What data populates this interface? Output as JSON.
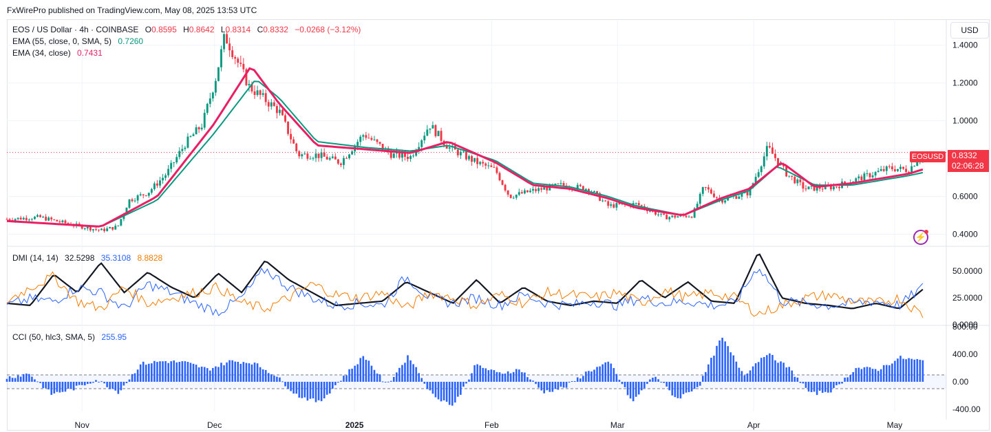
{
  "publisher": "FxWirePro published on TradingView.com, May 08, 2025 13:53 UTC",
  "currency_button": "USD",
  "legend": {
    "symbol": "EOS / US Dollar · 4h · COINBASE",
    "o_label": "O",
    "o": "0.8595",
    "h_label": "H",
    "h": "0.8642",
    "l_label": "L",
    "l": "0.8314",
    "c_label": "C",
    "c": "0.8332",
    "change": "−0.0268 (−3.12%)",
    "ema55_label": "EMA (55, close, 0, SMA, 5)",
    "ema55_value": "0.7260",
    "ema34_label": "EMA (34, close)",
    "ema34_value": "0.7431",
    "dmi_label": "DMI (14, 14)",
    "dmi_adx": "32.5298",
    "dmi_plus": "35.3108",
    "dmi_minus": "8.8828",
    "cci_label": "CCI (50, hlc3, SMA, 5)",
    "cci_value": "255.95"
  },
  "price_tag": {
    "symbol": "EOSUSD",
    "price": "0.8332",
    "countdown": "02:06:28"
  },
  "colors": {
    "up": "#089981",
    "down": "#f23645",
    "ema55": "#089981",
    "ema34": "#e91e63",
    "adx": "#131722",
    "di_plus": "#2962ff",
    "di_minus": "#f57c00",
    "cci": "#2962ff"
  },
  "chart_data": [
    {
      "type": "candlestick",
      "title": "EOS / US Dollar · 4h · COINBASE",
      "ylim": [
        0.34,
        1.53
      ],
      "yticks": [
        "1.4000",
        "1.2000",
        "1.0000",
        "0.6000",
        "0.4000"
      ],
      "xticks": [
        "Nov",
        "Dec",
        "2025",
        "Feb",
        "Mar",
        "Apr",
        "May"
      ],
      "close_path": [
        [
          0,
          0.48
        ],
        [
          0.035,
          0.49
        ],
        [
          0.07,
          0.45
        ],
        [
          0.1,
          0.42
        ],
        [
          0.118,
          0.44
        ],
        [
          0.13,
          0.58
        ],
        [
          0.15,
          0.62
        ],
        [
          0.17,
          0.72
        ],
        [
          0.19,
          0.88
        ],
        [
          0.208,
          0.98
        ],
        [
          0.222,
          1.22
        ],
        [
          0.232,
          1.45
        ],
        [
          0.242,
          1.35
        ],
        [
          0.258,
          1.18
        ],
        [
          0.29,
          1.05
        ],
        [
          0.31,
          0.82
        ],
        [
          0.33,
          0.82
        ],
        [
          0.355,
          0.78
        ],
        [
          0.38,
          0.93
        ],
        [
          0.41,
          0.82
        ],
        [
          0.43,
          0.81
        ],
        [
          0.45,
          0.98
        ],
        [
          0.47,
          0.86
        ],
        [
          0.5,
          0.78
        ],
        [
          0.52,
          0.74
        ],
        [
          0.535,
          0.6
        ],
        [
          0.56,
          0.63
        ],
        [
          0.59,
          0.66
        ],
        [
          0.62,
          0.64
        ],
        [
          0.64,
          0.55
        ],
        [
          0.67,
          0.56
        ],
        [
          0.7,
          0.49
        ],
        [
          0.73,
          0.5
        ],
        [
          0.742,
          0.65
        ],
        [
          0.76,
          0.58
        ],
        [
          0.79,
          0.62
        ],
        [
          0.81,
          0.86
        ],
        [
          0.83,
          0.72
        ],
        [
          0.85,
          0.64
        ],
        [
          0.88,
          0.65
        ],
        [
          0.91,
          0.7
        ],
        [
          0.94,
          0.75
        ],
        [
          0.96,
          0.74
        ],
        [
          0.975,
          0.83
        ]
      ],
      "ema55_path": [
        [
          0,
          0.47
        ],
        [
          0.1,
          0.44
        ],
        [
          0.16,
          0.58
        ],
        [
          0.22,
          0.93
        ],
        [
          0.265,
          1.22
        ],
        [
          0.29,
          1.12
        ],
        [
          0.33,
          0.89
        ],
        [
          0.38,
          0.86
        ],
        [
          0.43,
          0.84
        ],
        [
          0.47,
          0.87
        ],
        [
          0.52,
          0.79
        ],
        [
          0.56,
          0.67
        ],
        [
          0.6,
          0.65
        ],
        [
          0.64,
          0.6
        ],
        [
          0.67,
          0.55
        ],
        [
          0.72,
          0.5
        ],
        [
          0.76,
          0.58
        ],
        [
          0.79,
          0.63
        ],
        [
          0.82,
          0.76
        ],
        [
          0.86,
          0.66
        ],
        [
          0.9,
          0.66
        ],
        [
          0.96,
          0.71
        ],
        [
          0.975,
          0.726
        ]
      ],
      "ema34_path": [
        [
          0,
          0.47
        ],
        [
          0.1,
          0.44
        ],
        [
          0.16,
          0.6
        ],
        [
          0.22,
          0.98
        ],
        [
          0.26,
          1.29
        ],
        [
          0.29,
          1.09
        ],
        [
          0.33,
          0.87
        ],
        [
          0.38,
          0.85
        ],
        [
          0.43,
          0.83
        ],
        [
          0.47,
          0.89
        ],
        [
          0.52,
          0.78
        ],
        [
          0.56,
          0.66
        ],
        [
          0.6,
          0.64
        ],
        [
          0.64,
          0.59
        ],
        [
          0.67,
          0.54
        ],
        [
          0.72,
          0.5
        ],
        [
          0.76,
          0.59
        ],
        [
          0.79,
          0.64
        ],
        [
          0.825,
          0.78
        ],
        [
          0.86,
          0.65
        ],
        [
          0.9,
          0.67
        ],
        [
          0.96,
          0.72
        ],
        [
          0.975,
          0.743
        ]
      ]
    },
    {
      "type": "line",
      "title": "DMI (14, 14)",
      "ylim": [
        0,
        72
      ],
      "yticks": [
        "50.0000",
        "25.0000",
        "0.0000"
      ],
      "series": [
        {
          "name": "ADX",
          "values": [
            20,
            18,
            47,
            30,
            58,
            30,
            49,
            35,
            25,
            48,
            30,
            60,
            42,
            30,
            18,
            20,
            22,
            40,
            30,
            20,
            42,
            20,
            35,
            22,
            18,
            22,
            20,
            42,
            25,
            40,
            22,
            20,
            68,
            25,
            20,
            18,
            15,
            20,
            15,
            33
          ]
        },
        {
          "name": "+DI",
          "values": [
            18,
            24,
            22,
            35,
            30,
            15,
            38,
            30,
            20,
            12,
            25,
            52,
            35,
            25,
            18,
            20,
            18,
            45,
            25,
            20,
            25,
            18,
            28,
            20,
            18,
            22,
            18,
            25,
            20,
            22,
            18,
            20,
            55,
            22,
            20,
            18,
            20,
            22,
            18,
            35
          ]
        },
        {
          "name": "−DI",
          "values": [
            22,
            35,
            45,
            22,
            15,
            35,
            20,
            25,
            30,
            35,
            20,
            15,
            25,
            38,
            28,
            25,
            30,
            15,
            30,
            25,
            18,
            28,
            20,
            30,
            28,
            25,
            30,
            20,
            32,
            25,
            30,
            25,
            10,
            18,
            25,
            28,
            22,
            20,
            25,
            9
          ]
        }
      ]
    },
    {
      "type": "area",
      "title": "CCI (50, hlc3, SMA, 5)",
      "ylim": [
        -430,
        800
      ],
      "yticks": [
        "800.00",
        "400.00",
        "0.00",
        "-400.00"
      ],
      "band": [
        -100,
        100
      ],
      "values": [
        60,
        120,
        -180,
        -100,
        30,
        -150,
        260,
        300,
        280,
        180,
        300,
        280,
        100,
        -200,
        -300,
        50,
        380,
        -50,
        380,
        -180,
        -350,
        250,
        120,
        180,
        -150,
        -80,
        150,
        280,
        -300,
        100,
        -250,
        -50,
        650,
        100,
        420,
        200,
        -180,
        -120,
        200,
        180,
        350,
        300
      ]
    }
  ]
}
